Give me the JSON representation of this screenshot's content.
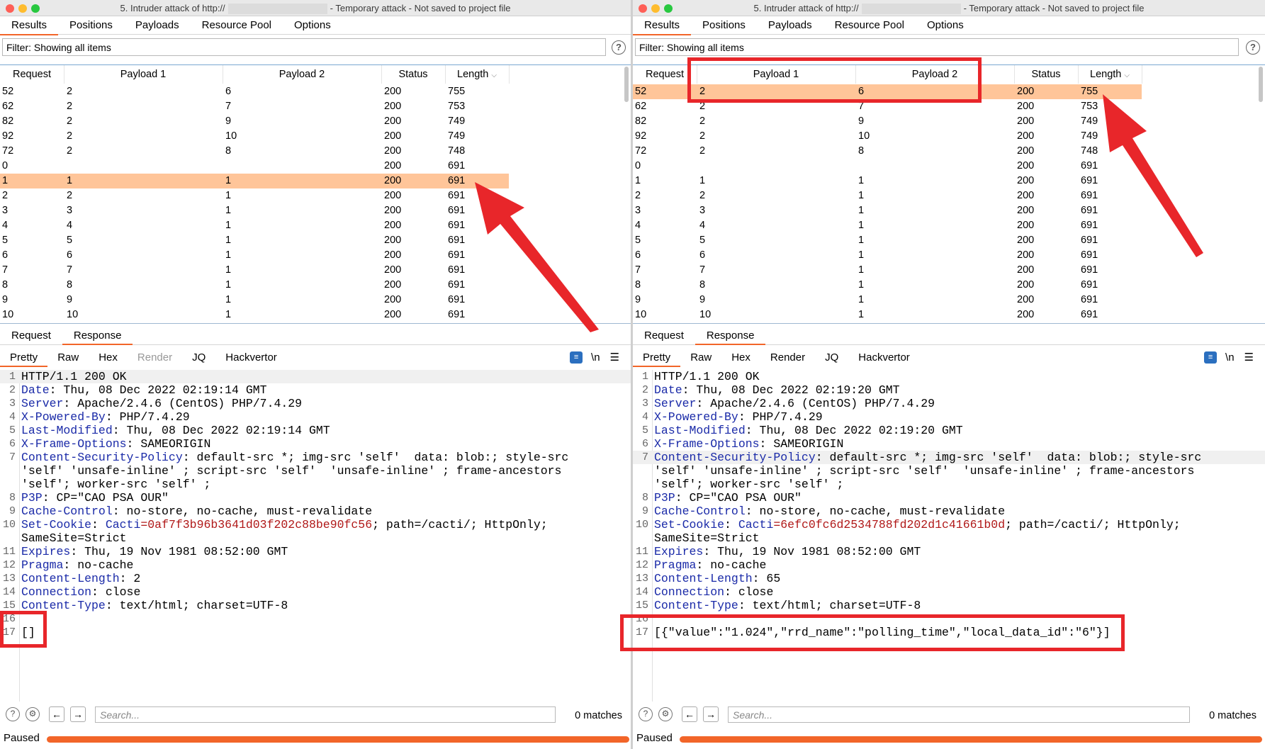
{
  "windows": [
    {
      "title_prefix": "5. Intruder attack of http://",
      "title_suffix": "- Temporary attack - Not saved to project file",
      "tabs": [
        "Results",
        "Positions",
        "Payloads",
        "Resource Pool",
        "Options"
      ],
      "active_tab": "Results",
      "filter_text": "Filter: Showing all items",
      "columns": [
        "Request",
        "Payload 1",
        "Payload 2",
        "Status",
        "Length"
      ],
      "rows": [
        [
          "52",
          "2",
          "6",
          "200",
          "755"
        ],
        [
          "62",
          "2",
          "7",
          "200",
          "753"
        ],
        [
          "82",
          "2",
          "9",
          "200",
          "749"
        ],
        [
          "92",
          "2",
          "10",
          "200",
          "749"
        ],
        [
          "72",
          "2",
          "8",
          "200",
          "748"
        ],
        [
          "0",
          "",
          "",
          "200",
          "691"
        ],
        [
          "1",
          "1",
          "1",
          "200",
          "691"
        ],
        [
          "2",
          "2",
          "1",
          "200",
          "691"
        ],
        [
          "3",
          "3",
          "1",
          "200",
          "691"
        ],
        [
          "4",
          "4",
          "1",
          "200",
          "691"
        ],
        [
          "5",
          "5",
          "1",
          "200",
          "691"
        ],
        [
          "6",
          "6",
          "1",
          "200",
          "691"
        ],
        [
          "7",
          "7",
          "1",
          "200",
          "691"
        ],
        [
          "8",
          "8",
          "1",
          "200",
          "691"
        ],
        [
          "9",
          "9",
          "1",
          "200",
          "691"
        ],
        [
          "10",
          "10",
          "1",
          "200",
          "691"
        ]
      ],
      "selected_row_index": 6,
      "subtabs": [
        "Request",
        "Response"
      ],
      "active_subtab": "Response",
      "view_tabs": [
        "Pretty",
        "Raw",
        "Hex",
        "Render",
        "JQ",
        "Hackvertor"
      ],
      "active_view": "Pretty",
      "response_lines": [
        {
          "n": "1",
          "k": "HTTP/1.1 200 OK",
          "v": ""
        },
        {
          "n": "2",
          "k": "Date",
          "v": ": Thu, 08 Dec 2022 02:19:14 GMT"
        },
        {
          "n": "3",
          "k": "Server",
          "v": ": Apache/2.4.6 (CentOS) PHP/7.4.29"
        },
        {
          "n": "4",
          "k": "X-Powered-By",
          "v": ": PHP/7.4.29"
        },
        {
          "n": "5",
          "k": "Last-Modified",
          "v": ": Thu, 08 Dec 2022 02:19:14 GMT"
        },
        {
          "n": "6",
          "k": "X-Frame-Options",
          "v": ": SAMEORIGIN"
        },
        {
          "n": "7",
          "k": "Content-Security-Policy",
          "v": ": default-src *; img-src 'self'  data: blob:; style-src"
        },
        {
          "n": "",
          "k": "",
          "v": "'self' 'unsafe-inline' ; script-src 'self'  'unsafe-inline' ; frame-ancestors"
        },
        {
          "n": "",
          "k": "",
          "v": "'self'; worker-src 'self' ;"
        },
        {
          "n": "8",
          "k": "P3P",
          "v": ": CP=\"CAO PSA OUR\""
        },
        {
          "n": "9",
          "k": "Cache-Control",
          "v": ": no-store, no-cache, must-revalidate"
        },
        {
          "n": "10",
          "k": "Set-Cookie",
          "v": ": ",
          "ck": "Cacti",
          "cv": "=0af7f3b96b3641d03f202c88be90fc56",
          "rest": "; path=/cacti/; HttpOnly;"
        },
        {
          "n": "",
          "k": "",
          "v": "SameSite=Strict"
        },
        {
          "n": "11",
          "k": "Expires",
          "v": ": Thu, 19 Nov 1981 08:52:00 GMT"
        },
        {
          "n": "12",
          "k": "Pragma",
          "v": ": no-cache"
        },
        {
          "n": "13",
          "k": "Content-Length",
          "v": ": 2"
        },
        {
          "n": "14",
          "k": "Connection",
          "v": ": close"
        },
        {
          "n": "15",
          "k": "Content-Type",
          "v": ": text/html; charset=UTF-8"
        },
        {
          "n": "16",
          "k": "",
          "v": ""
        },
        {
          "n": "17",
          "k": "",
          "v": "[]"
        }
      ],
      "search_placeholder": "Search...",
      "matches": "0 matches",
      "status": "Paused",
      "progress_fraction": 1.0
    },
    {
      "title_prefix": "5. Intruder attack of http://",
      "title_suffix": "- Temporary attack - Not saved to project file",
      "tabs": [
        "Results",
        "Positions",
        "Payloads",
        "Resource Pool",
        "Options"
      ],
      "active_tab": "Results",
      "filter_text": "Filter: Showing all items",
      "columns": [
        "Request",
        "Payload 1",
        "Payload 2",
        "Status",
        "Length"
      ],
      "rows": [
        [
          "52",
          "2",
          "6",
          "200",
          "755"
        ],
        [
          "62",
          "2",
          "7",
          "200",
          "753"
        ],
        [
          "82",
          "2",
          "9",
          "200",
          "749"
        ],
        [
          "92",
          "2",
          "10",
          "200",
          "749"
        ],
        [
          "72",
          "2",
          "8",
          "200",
          "748"
        ],
        [
          "0",
          "",
          "",
          "200",
          "691"
        ],
        [
          "1",
          "1",
          "1",
          "200",
          "691"
        ],
        [
          "2",
          "2",
          "1",
          "200",
          "691"
        ],
        [
          "3",
          "3",
          "1",
          "200",
          "691"
        ],
        [
          "4",
          "4",
          "1",
          "200",
          "691"
        ],
        [
          "5",
          "5",
          "1",
          "200",
          "691"
        ],
        [
          "6",
          "6",
          "1",
          "200",
          "691"
        ],
        [
          "7",
          "7",
          "1",
          "200",
          "691"
        ],
        [
          "8",
          "8",
          "1",
          "200",
          "691"
        ],
        [
          "9",
          "9",
          "1",
          "200",
          "691"
        ],
        [
          "10",
          "10",
          "1",
          "200",
          "691"
        ]
      ],
      "selected_row_index": 0,
      "subtabs": [
        "Request",
        "Response"
      ],
      "active_subtab": "Response",
      "view_tabs": [
        "Pretty",
        "Raw",
        "Hex",
        "Render",
        "JQ",
        "Hackvertor"
      ],
      "active_view": "Pretty",
      "response_lines": [
        {
          "n": "1",
          "k": "HTTP/1.1 200 OK",
          "v": ""
        },
        {
          "n": "2",
          "k": "Date",
          "v": ": Thu, 08 Dec 2022 02:19:20 GMT"
        },
        {
          "n": "3",
          "k": "Server",
          "v": ": Apache/2.4.6 (CentOS) PHP/7.4.29"
        },
        {
          "n": "4",
          "k": "X-Powered-By",
          "v": ": PHP/7.4.29"
        },
        {
          "n": "5",
          "k": "Last-Modified",
          "v": ": Thu, 08 Dec 2022 02:19:20 GMT"
        },
        {
          "n": "6",
          "k": "X-Frame-Options",
          "v": ": SAMEORIGIN"
        },
        {
          "n": "7",
          "k": "Content-Security-Policy",
          "v": ": default-src *; img-src 'self'  data: blob:; style-src"
        },
        {
          "n": "",
          "k": "",
          "v": "'self' 'unsafe-inline' ; script-src 'self'  'unsafe-inline' ; frame-ancestors"
        },
        {
          "n": "",
          "k": "",
          "v": "'self'; worker-src 'self' ;"
        },
        {
          "n": "8",
          "k": "P3P",
          "v": ": CP=\"CAO PSA OUR\""
        },
        {
          "n": "9",
          "k": "Cache-Control",
          "v": ": no-store, no-cache, must-revalidate"
        },
        {
          "n": "10",
          "k": "Set-Cookie",
          "v": ": ",
          "ck": "Cacti",
          "cv": "=6efc0fc6d2534788fd202d1c41661b0d",
          "rest": "; path=/cacti/; HttpOnly;"
        },
        {
          "n": "",
          "k": "",
          "v": "SameSite=Strict"
        },
        {
          "n": "11",
          "k": "Expires",
          "v": ": Thu, 19 Nov 1981 08:52:00 GMT"
        },
        {
          "n": "12",
          "k": "Pragma",
          "v": ": no-cache"
        },
        {
          "n": "13",
          "k": "Content-Length",
          "v": ": 65"
        },
        {
          "n": "14",
          "k": "Connection",
          "v": ": close"
        },
        {
          "n": "15",
          "k": "Content-Type",
          "v": ": text/html; charset=UTF-8"
        },
        {
          "n": "16",
          "k": "",
          "v": ""
        },
        {
          "n": "17",
          "k": "",
          "v": "[{\"value\":\"1.024\",\"rrd_name\":\"polling_time\",\"local_data_id\":\"6\"}]"
        }
      ],
      "search_placeholder": "Search...",
      "matches": "0 matches",
      "status": "Paused",
      "progress_fraction": 1.0
    }
  ],
  "icons": {
    "help": "help-icon",
    "settings": "gear-icon",
    "back": "arrow-left-icon",
    "forward": "arrow-right-icon",
    "wrap": "word-wrap-icon",
    "newline": "newline-icon",
    "menu": "menu-icon"
  },
  "colors": {
    "accent": "#f26529",
    "selected_row": "#ffc599",
    "annotation_red": "#e8262a",
    "header_key": "#1a2aa8",
    "cookie_value": "#b01818"
  }
}
